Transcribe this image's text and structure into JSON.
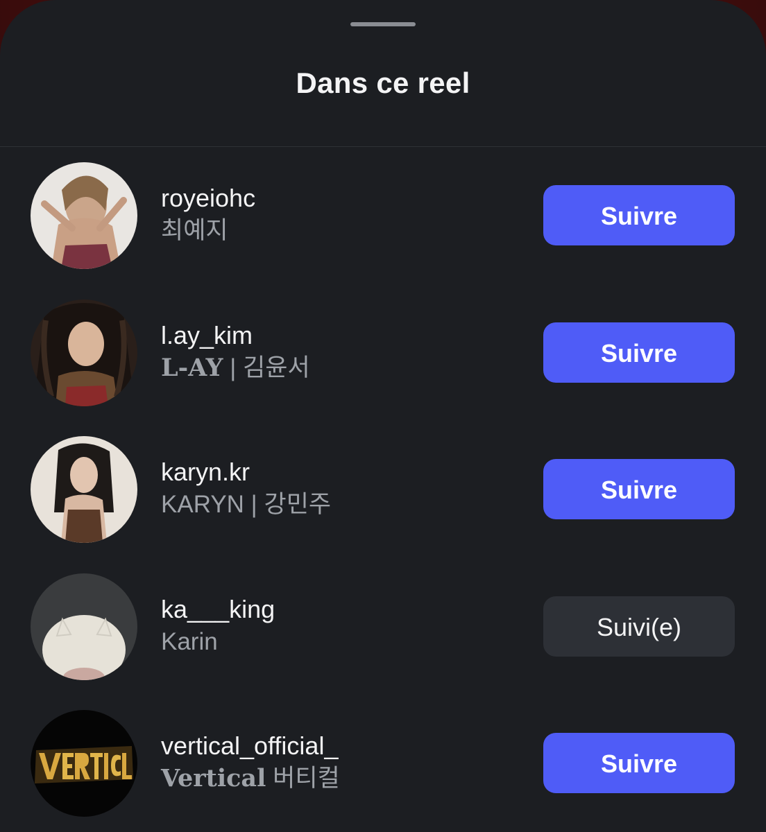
{
  "sheet": {
    "title": "Dans ce reel"
  },
  "people": [
    {
      "username": "royeiohc",
      "fullname_prefix": "",
      "fullname": "최예지",
      "button": "Suivre",
      "following": false,
      "avatar_icon": "profile-photo"
    },
    {
      "username": "l.ay_kim",
      "fullname_prefix": "L-AY",
      "fullname": "| 김윤서",
      "button": "Suivre",
      "following": false,
      "avatar_icon": "profile-photo"
    },
    {
      "username": "karyn.kr",
      "fullname_prefix": "",
      "fullname": "KARYN | 강민주",
      "button": "Suivre",
      "following": false,
      "avatar_icon": "profile-photo"
    },
    {
      "username": "ka___king",
      "fullname_prefix": "",
      "fullname": "Karin",
      "button": "Suivi(e)",
      "following": true,
      "avatar_icon": "profile-photo"
    },
    {
      "username": "vertical_official_",
      "fullname_prefix": "Vertical",
      "fullname": "버티컬",
      "button": "Suivre",
      "following": false,
      "avatar_icon": "vertical-logo"
    }
  ],
  "colors": {
    "sheet_bg": "#1c1e22",
    "follow_button": "#4f5cf7",
    "following_button": "#2d3036",
    "primary_text": "#f4f4f5",
    "secondary_text": "#9ea2a8"
  }
}
